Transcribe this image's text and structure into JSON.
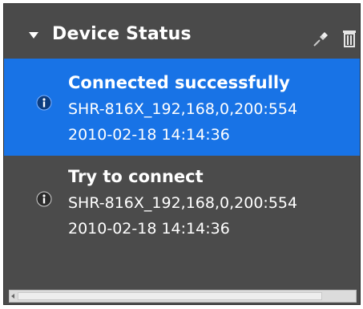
{
  "panel": {
    "title": "Device Status",
    "icons": {
      "collapse": "collapse-arrow-icon",
      "pin": "pin-icon",
      "delete": "trash-icon"
    }
  },
  "items": [
    {
      "status": "Connected successfully",
      "device": "SHR-816X_192,168,0,200:554",
      "timestamp": "2010-02-18 14:14:36",
      "icon": "info-icon",
      "selected": true
    },
    {
      "status": "Try to connect",
      "device": "SHR-816X_192,168,0,200:554",
      "timestamp": "2010-02-18 14:14:36",
      "icon": "info-icon",
      "selected": false
    }
  ],
  "colors": {
    "panel_bg": "#4b4b4b",
    "selected_bg": "#1873e6",
    "text": "#ffffff"
  }
}
